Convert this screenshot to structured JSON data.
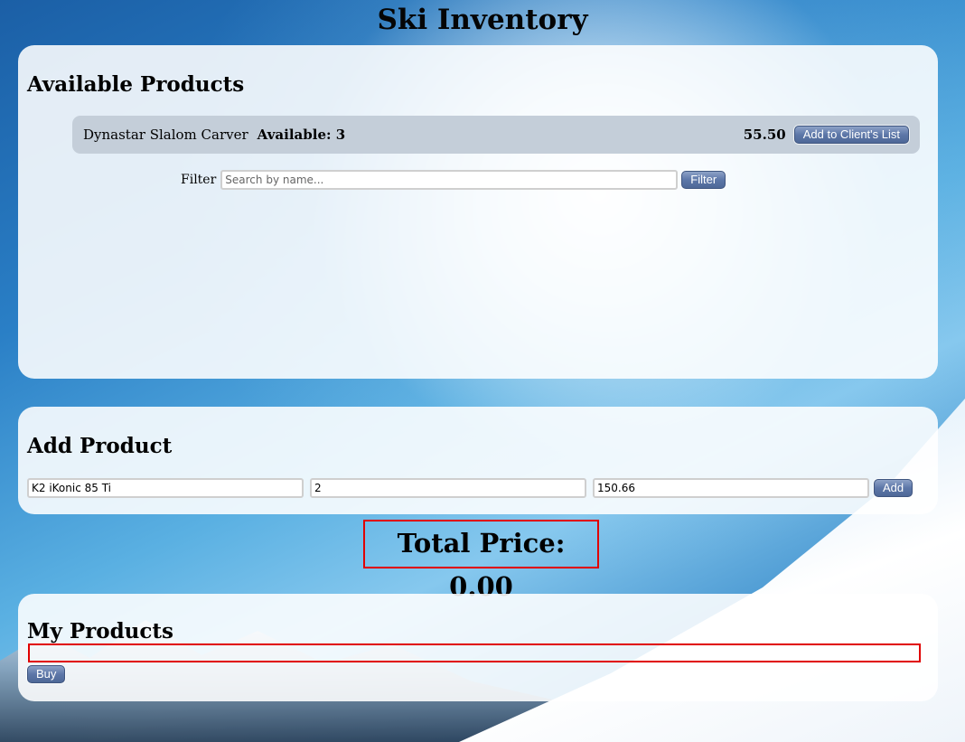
{
  "page": {
    "title": "Ski Inventory"
  },
  "available": {
    "heading": "Available Products",
    "products": [
      {
        "name": "Dynastar Slalom Carver",
        "availability": "Available: 3",
        "price": "55.50",
        "action_label": "Add to Client's List"
      }
    ],
    "filter": {
      "label": "Filter",
      "placeholder": "Search by name...",
      "value": "",
      "button_label": "Filter"
    }
  },
  "add_product": {
    "heading": "Add Product",
    "name_value": "K2 iKonic 85 Ti",
    "quantity_value": "2",
    "price_value": "150.66",
    "button_label": "Add"
  },
  "total": {
    "text": "Total Price: 0.00"
  },
  "my_products": {
    "heading": "My Products",
    "buy_label": "Buy"
  },
  "colors": {
    "accent_button": "#5d77a8",
    "highlight_border": "#e00000",
    "product_row_bg": "#c4ced9"
  }
}
